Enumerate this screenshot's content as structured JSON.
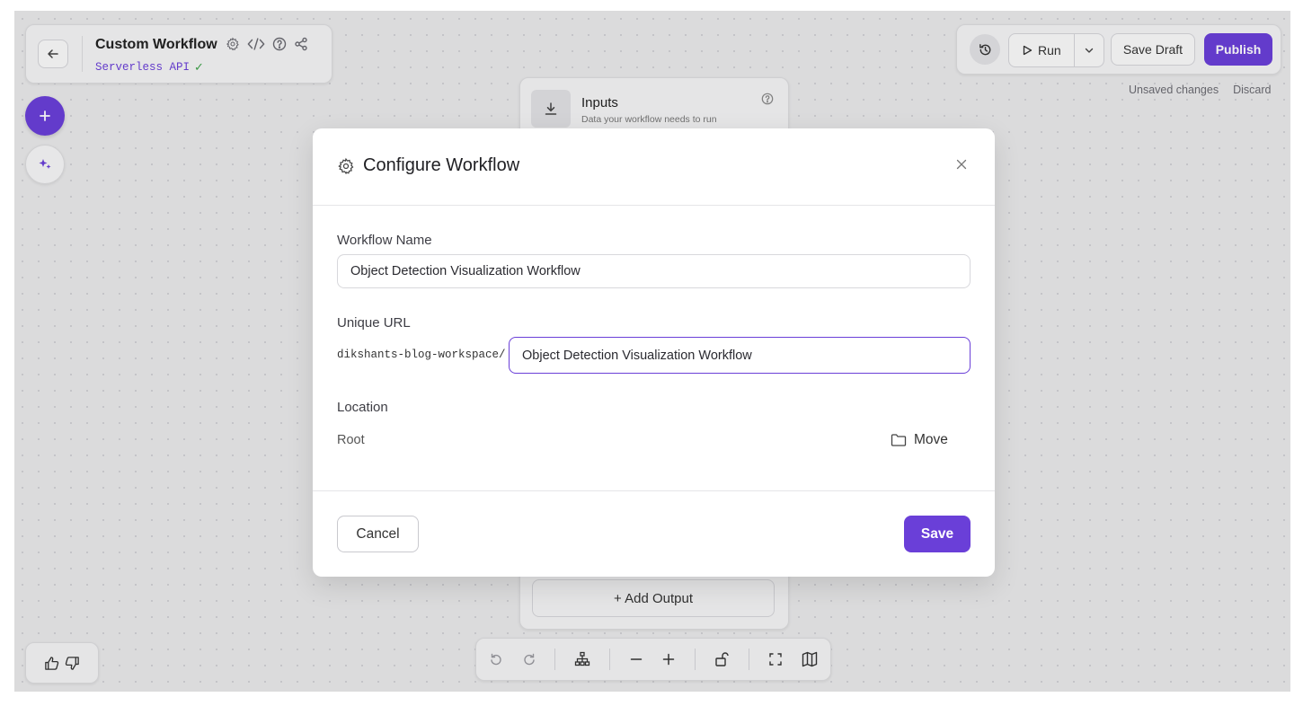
{
  "header": {
    "title": "Custom Workflow",
    "subtitle": "Serverless API",
    "subtitle_check": "✓"
  },
  "toolbar": {
    "run_label": "Run",
    "save_draft_label": "Save Draft",
    "publish_label": "Publish",
    "unsaved_label": "Unsaved changes",
    "discard_label": "Discard"
  },
  "inputs_node": {
    "title": "Inputs",
    "description": "Data your workflow needs to run"
  },
  "outputs_node": {
    "add_output_label": "+ Add Output"
  },
  "modal": {
    "title": "Configure Workflow",
    "workflow_name_label": "Workflow Name",
    "workflow_name_value": "Object Detection Visualization Workflow",
    "unique_url_label": "Unique URL",
    "url_prefix": "dikshants-blog-workspace/",
    "url_value": "Object Detection Visualization Workflow",
    "location_label": "Location",
    "location_value": "Root",
    "move_label": "Move",
    "cancel_label": "Cancel",
    "save_label": "Save"
  },
  "colors": {
    "accent": "#6a3fd8",
    "canvas": "#e9e9ea",
    "subtitle": "#6a3fd8",
    "check": "#3fa24a"
  }
}
